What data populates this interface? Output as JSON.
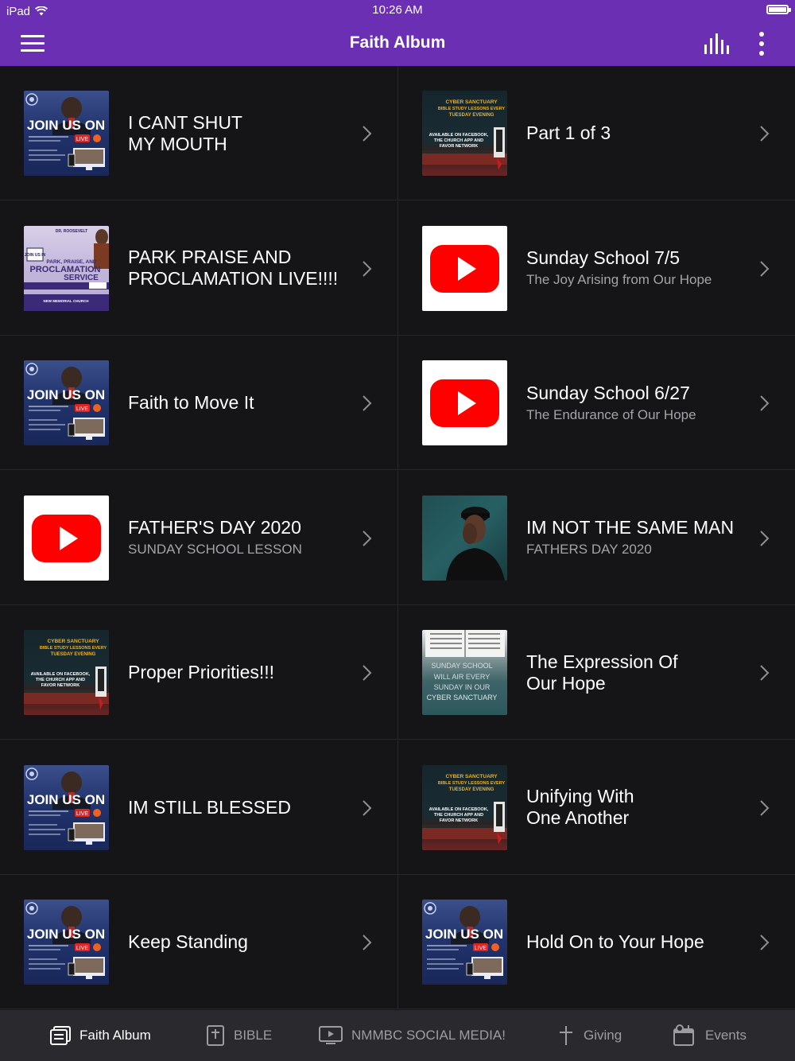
{
  "status_bar": {
    "device": "iPad",
    "time": "10:26 AM",
    "battery_level": 1.0
  },
  "nav": {
    "title": "Faith Album",
    "menu_icon": "hamburger-icon",
    "equalizer_icon": "equalizer-icon",
    "more_icon": "more-vertical-icon"
  },
  "accent_color": "#6a2fb2",
  "items": [
    {
      "title": "I CANT SHUT\nMY MOUTH",
      "subtitle": "",
      "thumb": "join-us-on-flyer"
    },
    {
      "title": "Part 1 of 3",
      "subtitle": "",
      "thumb": "cyber-sanctuary-flyer"
    },
    {
      "title": "PARK PRAISE AND\nPROCLAMATION LIVE!!!!",
      "subtitle": "",
      "thumb": "park-praise-flyer"
    },
    {
      "title": "Sunday School 7/5",
      "subtitle": "The Joy Arising from Our Hope",
      "thumb": "youtube-logo"
    },
    {
      "title": "Faith to Move It",
      "subtitle": "",
      "thumb": "join-us-on-flyer"
    },
    {
      "title": "Sunday School 6/27",
      "subtitle": "The Endurance of Our Hope",
      "thumb": "youtube-logo"
    },
    {
      "title": "FATHER'S DAY 2020",
      "subtitle": "SUNDAY SCHOOL LESSON",
      "thumb": "youtube-logo"
    },
    {
      "title": "IM NOT THE SAME MAN",
      "subtitle": "FATHERS DAY 2020",
      "thumb": "man-portrait-photo"
    },
    {
      "title": "Proper Priorities!!!",
      "subtitle": "",
      "thumb": "cyber-sanctuary-flyer"
    },
    {
      "title": "The Expression Of\nOur Hope",
      "subtitle": "",
      "thumb": "sunday-school-flyer"
    },
    {
      "title": "IM STILL BLESSED",
      "subtitle": "",
      "thumb": "join-us-on-flyer"
    },
    {
      "title": "Unifying With\nOne Another",
      "subtitle": "",
      "thumb": "cyber-sanctuary-flyer"
    },
    {
      "title": "Keep Standing",
      "subtitle": "",
      "thumb": "join-us-on-flyer"
    },
    {
      "title": "Hold On to Your Hope",
      "subtitle": "",
      "thumb": "join-us-on-flyer"
    }
  ],
  "thumb_text": {
    "join": {
      "line1": "JOIN US ON",
      "live": "LIVE"
    },
    "cyber": {
      "line1": "CYBER SANCTUARY",
      "line2": "BIBLE STUDY LESSONS EVERY",
      "line3": "TUESDAY EVENING",
      "line4": "AVAILABLE ON FACEBOOK,",
      "line5": "THE CHURCH APP AND",
      "line6": "FAVOR NETWORK"
    },
    "park": {
      "line1": "DR. ROOSEVELT",
      "line2": "JOIN US IN",
      "line3": "PARK, PRAISE, AND",
      "line4": "PROCLAMATION",
      "line5": "SERVICE",
      "line6": "NEW MEMORIAL CHURCH"
    },
    "sunday": {
      "line1": "SUNDAY SCHOOL",
      "line2": "WILL AIR EVERY",
      "line3": "SUNDAY IN OUR",
      "line4": "CYBER SANCTUARY"
    }
  },
  "tabs": [
    {
      "label": "Faith Album",
      "icon": "album-icon",
      "active": true
    },
    {
      "label": "BIBLE",
      "icon": "bible-icon",
      "active": false
    },
    {
      "label": "NMMBC SOCIAL MEDIA!",
      "icon": "tv-icon",
      "active": false
    },
    {
      "label": "Giving",
      "icon": "cross-icon",
      "active": false
    },
    {
      "label": "Events",
      "icon": "calendar-icon",
      "active": false
    }
  ]
}
